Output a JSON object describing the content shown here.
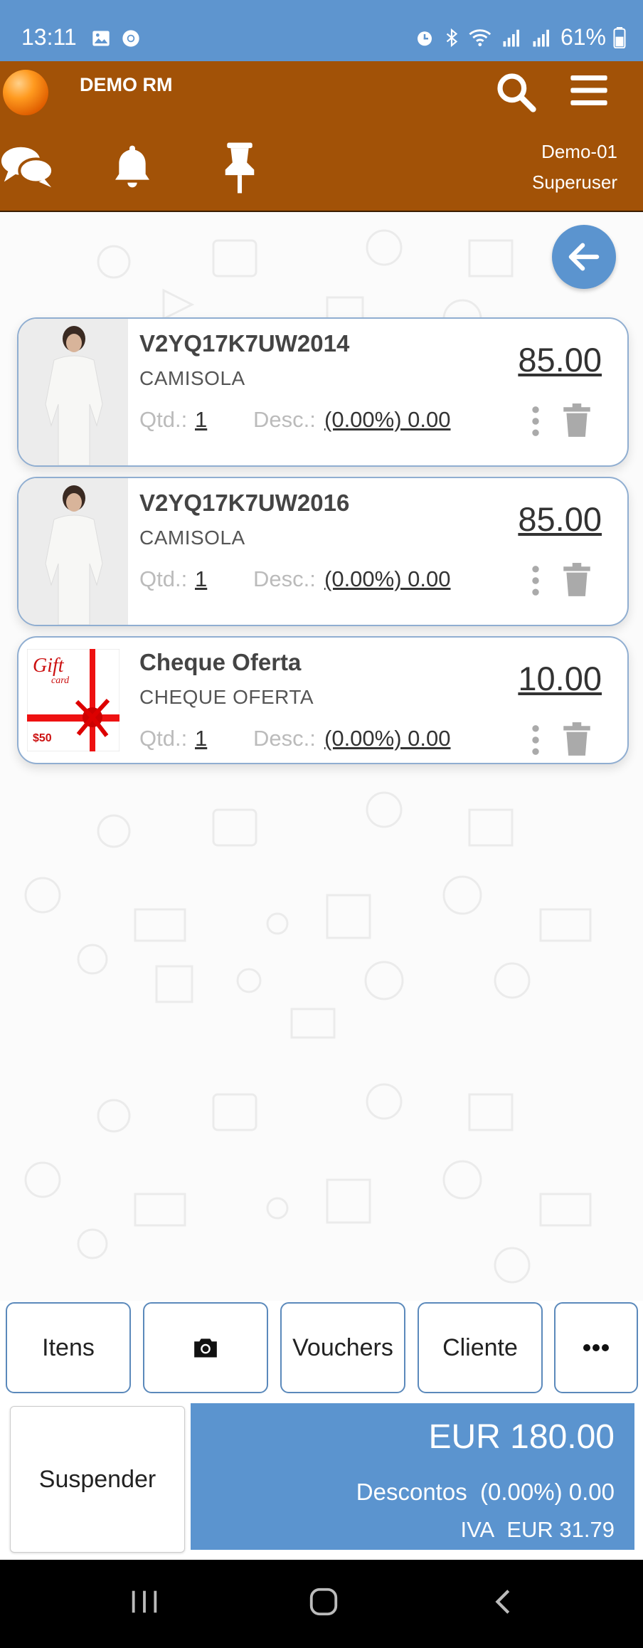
{
  "status_bar": {
    "time": "13:11",
    "battery": "61%",
    "icons_left": [
      "gallery-icon",
      "chrome-icon"
    ],
    "icons_right": [
      "alarm-icon",
      "bluetooth-icon",
      "wifi-icon",
      "signal-icon",
      "signal-icon",
      "battery-icon"
    ]
  },
  "header": {
    "title": "DEMO RM",
    "store": "Demo-01",
    "user": "Superuser",
    "colors": {
      "brand": "#a25207",
      "accent": "#5b94cf"
    }
  },
  "cart_items": [
    {
      "code": "V2YQ17K7UW2014",
      "description": "CAMISOLA",
      "qty_label": "Qtd.:",
      "qty": "1",
      "disc_label": "Desc.:",
      "discount": "(0.00%) 0.00",
      "price": "85.00",
      "thumb": "white-sweatsuit"
    },
    {
      "code": "V2YQ17K7UW2016",
      "description": "CAMISOLA",
      "qty_label": "Qtd.:",
      "qty": "1",
      "disc_label": "Desc.:",
      "discount": "(0.00%) 0.00",
      "price": "85.00",
      "thumb": "white-sweatsuit"
    },
    {
      "code": "Cheque Oferta",
      "description": "CHEQUE OFERTA",
      "qty_label": "Qtd.:",
      "qty": "1",
      "disc_label": "Desc.:",
      "discount": "(0.00%) 0.00",
      "price": "10.00",
      "thumb": "gift-card",
      "thumb_text": {
        "gift": "Gift",
        "card": "card",
        "value": "$50"
      }
    }
  ],
  "actions": {
    "items": "Itens",
    "vouchers": "Vouchers",
    "client": "Cliente",
    "suspend": "Suspender"
  },
  "totals": {
    "total": "EUR 180.00",
    "discounts_label": "Descontos",
    "discounts": "(0.00%) 0.00",
    "vat_label": "IVA",
    "vat": "EUR 31.79"
  }
}
